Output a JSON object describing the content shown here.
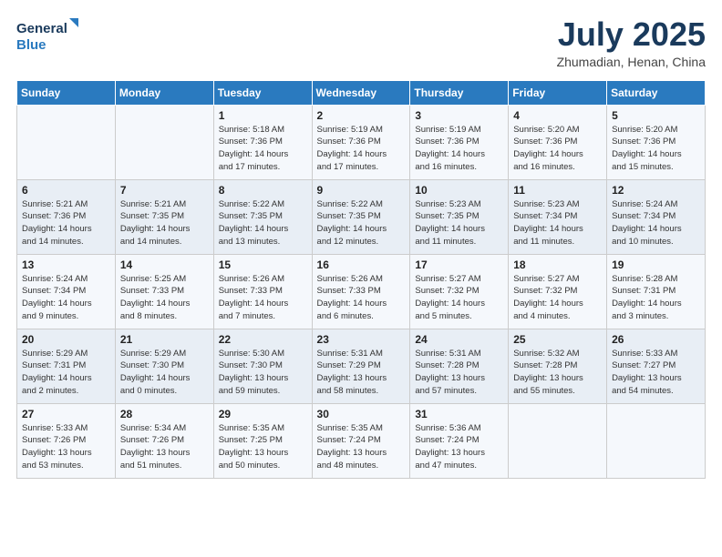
{
  "header": {
    "logo_line1": "General",
    "logo_line2": "Blue",
    "month_title": "July 2025",
    "location": "Zhumadian, Henan, China"
  },
  "weekdays": [
    "Sunday",
    "Monday",
    "Tuesday",
    "Wednesday",
    "Thursday",
    "Friday",
    "Saturday"
  ],
  "weeks": [
    [
      {
        "day": "",
        "info": ""
      },
      {
        "day": "",
        "info": ""
      },
      {
        "day": "1",
        "info": "Sunrise: 5:18 AM\nSunset: 7:36 PM\nDaylight: 14 hours\nand 17 minutes."
      },
      {
        "day": "2",
        "info": "Sunrise: 5:19 AM\nSunset: 7:36 PM\nDaylight: 14 hours\nand 17 minutes."
      },
      {
        "day": "3",
        "info": "Sunrise: 5:19 AM\nSunset: 7:36 PM\nDaylight: 14 hours\nand 16 minutes."
      },
      {
        "day": "4",
        "info": "Sunrise: 5:20 AM\nSunset: 7:36 PM\nDaylight: 14 hours\nand 16 minutes."
      },
      {
        "day": "5",
        "info": "Sunrise: 5:20 AM\nSunset: 7:36 PM\nDaylight: 14 hours\nand 15 minutes."
      }
    ],
    [
      {
        "day": "6",
        "info": "Sunrise: 5:21 AM\nSunset: 7:36 PM\nDaylight: 14 hours\nand 14 minutes."
      },
      {
        "day": "7",
        "info": "Sunrise: 5:21 AM\nSunset: 7:35 PM\nDaylight: 14 hours\nand 14 minutes."
      },
      {
        "day": "8",
        "info": "Sunrise: 5:22 AM\nSunset: 7:35 PM\nDaylight: 14 hours\nand 13 minutes."
      },
      {
        "day": "9",
        "info": "Sunrise: 5:22 AM\nSunset: 7:35 PM\nDaylight: 14 hours\nand 12 minutes."
      },
      {
        "day": "10",
        "info": "Sunrise: 5:23 AM\nSunset: 7:35 PM\nDaylight: 14 hours\nand 11 minutes."
      },
      {
        "day": "11",
        "info": "Sunrise: 5:23 AM\nSunset: 7:34 PM\nDaylight: 14 hours\nand 11 minutes."
      },
      {
        "day": "12",
        "info": "Sunrise: 5:24 AM\nSunset: 7:34 PM\nDaylight: 14 hours\nand 10 minutes."
      }
    ],
    [
      {
        "day": "13",
        "info": "Sunrise: 5:24 AM\nSunset: 7:34 PM\nDaylight: 14 hours\nand 9 minutes."
      },
      {
        "day": "14",
        "info": "Sunrise: 5:25 AM\nSunset: 7:33 PM\nDaylight: 14 hours\nand 8 minutes."
      },
      {
        "day": "15",
        "info": "Sunrise: 5:26 AM\nSunset: 7:33 PM\nDaylight: 14 hours\nand 7 minutes."
      },
      {
        "day": "16",
        "info": "Sunrise: 5:26 AM\nSunset: 7:33 PM\nDaylight: 14 hours\nand 6 minutes."
      },
      {
        "day": "17",
        "info": "Sunrise: 5:27 AM\nSunset: 7:32 PM\nDaylight: 14 hours\nand 5 minutes."
      },
      {
        "day": "18",
        "info": "Sunrise: 5:27 AM\nSunset: 7:32 PM\nDaylight: 14 hours\nand 4 minutes."
      },
      {
        "day": "19",
        "info": "Sunrise: 5:28 AM\nSunset: 7:31 PM\nDaylight: 14 hours\nand 3 minutes."
      }
    ],
    [
      {
        "day": "20",
        "info": "Sunrise: 5:29 AM\nSunset: 7:31 PM\nDaylight: 14 hours\nand 2 minutes."
      },
      {
        "day": "21",
        "info": "Sunrise: 5:29 AM\nSunset: 7:30 PM\nDaylight: 14 hours\nand 0 minutes."
      },
      {
        "day": "22",
        "info": "Sunrise: 5:30 AM\nSunset: 7:30 PM\nDaylight: 13 hours\nand 59 minutes."
      },
      {
        "day": "23",
        "info": "Sunrise: 5:31 AM\nSunset: 7:29 PM\nDaylight: 13 hours\nand 58 minutes."
      },
      {
        "day": "24",
        "info": "Sunrise: 5:31 AM\nSunset: 7:28 PM\nDaylight: 13 hours\nand 57 minutes."
      },
      {
        "day": "25",
        "info": "Sunrise: 5:32 AM\nSunset: 7:28 PM\nDaylight: 13 hours\nand 55 minutes."
      },
      {
        "day": "26",
        "info": "Sunrise: 5:33 AM\nSunset: 7:27 PM\nDaylight: 13 hours\nand 54 minutes."
      }
    ],
    [
      {
        "day": "27",
        "info": "Sunrise: 5:33 AM\nSunset: 7:26 PM\nDaylight: 13 hours\nand 53 minutes."
      },
      {
        "day": "28",
        "info": "Sunrise: 5:34 AM\nSunset: 7:26 PM\nDaylight: 13 hours\nand 51 minutes."
      },
      {
        "day": "29",
        "info": "Sunrise: 5:35 AM\nSunset: 7:25 PM\nDaylight: 13 hours\nand 50 minutes."
      },
      {
        "day": "30",
        "info": "Sunrise: 5:35 AM\nSunset: 7:24 PM\nDaylight: 13 hours\nand 48 minutes."
      },
      {
        "day": "31",
        "info": "Sunrise: 5:36 AM\nSunset: 7:24 PM\nDaylight: 13 hours\nand 47 minutes."
      },
      {
        "day": "",
        "info": ""
      },
      {
        "day": "",
        "info": ""
      }
    ]
  ]
}
